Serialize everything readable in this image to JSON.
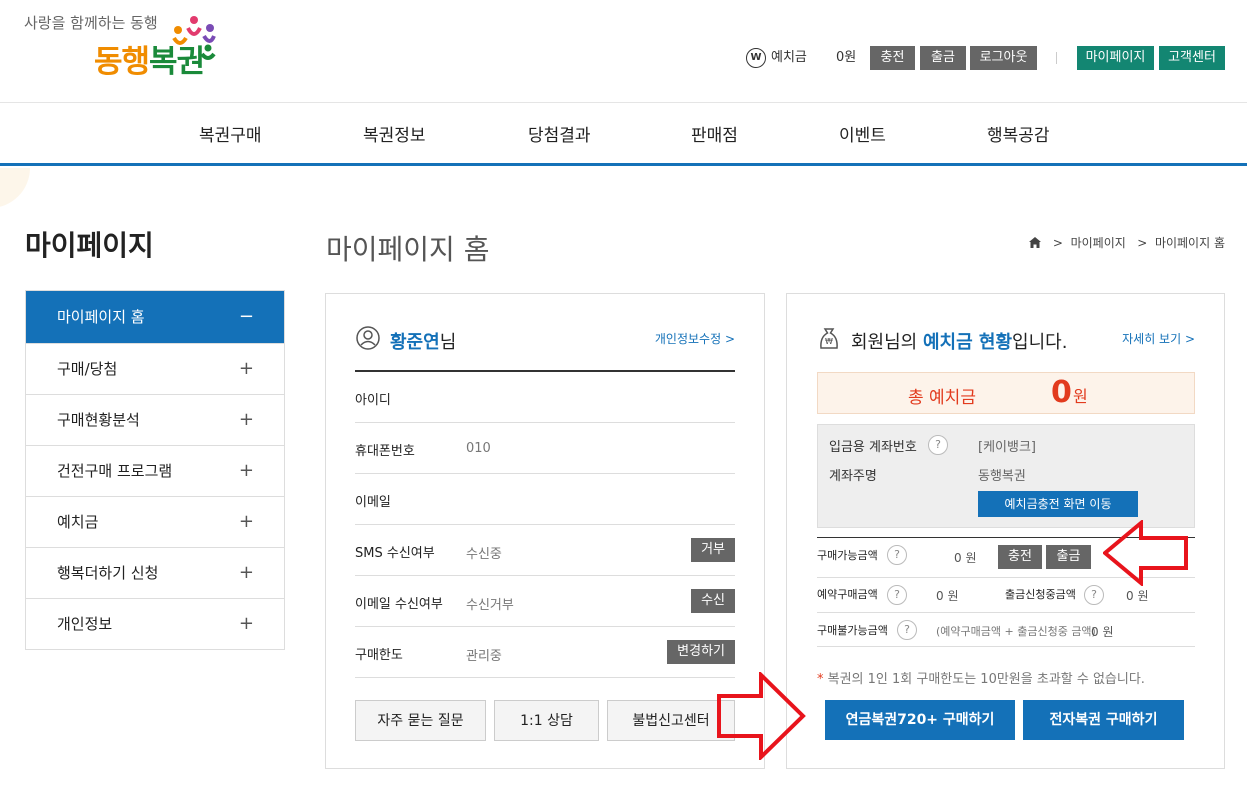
{
  "header": {
    "tagline": "사랑을 함께하는 동행",
    "logo_a": "동행",
    "logo_b": "복권",
    "deposit_icon": "W",
    "deposit_label": "예치금",
    "deposit_value": "0원",
    "buttons": [
      "충전",
      "출금",
      "로그아웃"
    ],
    "right_buttons": [
      "마이페이지",
      "고객센터"
    ]
  },
  "nav": [
    "복권구매",
    "복권정보",
    "당첨결과",
    "판매점",
    "이벤트",
    "행복공감"
  ],
  "sidebar": {
    "title": "마이페이지",
    "items": [
      {
        "label": "마이페이지 홈",
        "icon": "−"
      },
      {
        "label": "구매/당첨",
        "icon": "+"
      },
      {
        "label": "구매현황분석",
        "icon": "+"
      },
      {
        "label": "건전구매 프로그램",
        "icon": "+"
      },
      {
        "label": "예치금",
        "icon": "+"
      },
      {
        "label": "행복더하기 신청",
        "icon": "+"
      },
      {
        "label": "개인정보",
        "icon": "+"
      }
    ]
  },
  "main": {
    "title": "마이페이지 홈",
    "breadcrumb": [
      "마이페이지",
      "마이페이지 홈"
    ]
  },
  "profile": {
    "name": "황준연",
    "name_suffix": "님",
    "edit_link": "개인정보수정",
    "rows": [
      {
        "label": "아이디",
        "value": "",
        "button": ""
      },
      {
        "label": "휴대폰번호",
        "value": "010",
        "button": ""
      },
      {
        "label": "이메일",
        "value": "",
        "button": ""
      },
      {
        "label": "SMS 수신여부",
        "value": "수신중",
        "button": "거부"
      },
      {
        "label": "이메일 수신여부",
        "value": "수신거부",
        "button": "수신"
      },
      {
        "label": "구매한도",
        "value": "관리중",
        "button": "변경하기"
      }
    ],
    "bottom_buttons": [
      "자주 묻는 질문",
      "1:1 상담",
      "불법신고센터"
    ]
  },
  "deposit": {
    "title_a": "회원님의 ",
    "title_b": "예치금 현황",
    "title_c": "입니다.",
    "detail_link": "자세히 보기",
    "total_label": "총 예치금",
    "total_value": "0",
    "total_unit": "원",
    "account_label": "입금용 계좌번호",
    "account_value": "[케이뱅크]",
    "owner_label": "계좌주명",
    "owner_value": "동행복권",
    "charge_button": "예치금충전 화면 이동",
    "available_label": "구매가능금액",
    "available_value": "0 원",
    "charge_small": "충전",
    "withdraw_small": "출금",
    "reserved_label": "예약구매금액",
    "reserved_value": "0 원",
    "withdraw_req_label": "출금신청중금액",
    "withdraw_req_value": "0 원",
    "unavailable_label": "구매불가능금액",
    "unavailable_formula": "(예약구매금액 + 출금신청중 금액)",
    "unavailable_value": "0 원",
    "note_star": "*",
    "note": " 복권의 1인 1회 구매한도는 10만원을 초과할 수 없습니다.",
    "buy_buttons": [
      "연금복권720+ 구매하기",
      "전자복권 구매하기"
    ]
  },
  "colors": {
    "primary": "#1471b8",
    "teal": "#138672",
    "red": "#e23b1e",
    "arrow": "#e8141c"
  }
}
